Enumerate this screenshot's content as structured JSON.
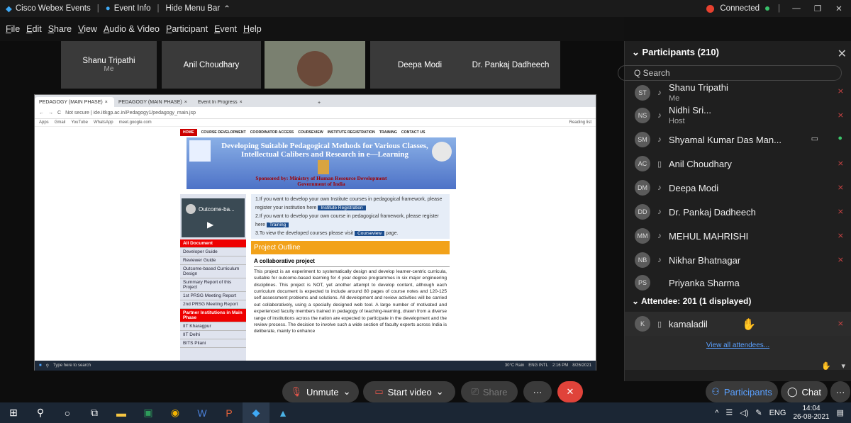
{
  "titlebar": {
    "app": "Cisco Webex Events",
    "event_info": "Event Info",
    "hide_menu": "Hide Menu Bar",
    "connected": "Connected"
  },
  "menu": [
    "File",
    "Edit",
    "Share",
    "View",
    "Audio & Video",
    "Participant",
    "Event",
    "Help"
  ],
  "tiles": [
    {
      "name": "Shanu Tripathi",
      "sub": "Me"
    },
    {
      "name": "Anil Choudhary"
    },
    {
      "name": "Deepa Modi"
    },
    {
      "name": "Dr. Pankaj Dadheech"
    }
  ],
  "browser": {
    "tabs": [
      "PEDAGOGY (MAIN PHASE)",
      "PEDAGOGY (MAIN PHASE)",
      "Event In Progress"
    ],
    "address": "Not secure | ide.iitkgp.ac.in/Pedagogy1/pedagogy_main.jsp",
    "bookmarks": [
      "Apps",
      "Gmail",
      "YouTube",
      "WhatsApp",
      "meet.google.com"
    ],
    "reading_list": "Reading list"
  },
  "site": {
    "nav": [
      "HOME",
      "COURSE DEVELOPMENT",
      "COORDINATOR ACCESS",
      "COURSEVIEW",
      "INSTITUTE REGISTRATION",
      "TRAINING",
      "CONTACT US"
    ],
    "title": "Developing Suitable Pedagogical Methods for Various Classes, Intellectual Calibers and Research in e—Learning",
    "sponsor": "Sponsored by: Ministry of Human Resource Development",
    "govt": "Government of India",
    "video_label": "Outcome-ba...",
    "left_nav": [
      "All Document",
      "Developer Guide",
      "Reviewer Guide",
      "Outcome-based Curriculum Design",
      "Summary Report of this Project",
      "1st PRSG Meeting Report",
      "2nd PRSG Meeting Report",
      "Partner Institutions in Main Phase",
      "IIT Kharagpur",
      "IIT Delhi",
      "BITS Pilani"
    ],
    "p1": "1.If you want to develop your own Institute courses in pedagogical framework, please register your institution here",
    "btn1": "Institute Registration",
    "p2": "2.If you want to develop your own course in pedagogical framework, please register here",
    "btn2": "Training",
    "p3a": "3.To view the developed courses please visit",
    "btn3": "Courseview",
    "p3b": "page.",
    "outline": "Project Outline",
    "collab": "A collaborative project",
    "body": "This project is an experiment to systematically design and develop learner-centric curricula, suitable for outcome-based learning for 4 year degree programmes in six major engineering disciplines. This project is NOT, yet another attempt to develop content, although each curriculum document is expected to include around 80 pages of course notes and 120-125 self assessment problems and solutions. All development and review activities will be carried out collaboratively, using a specially designed web tool. A large number of motivated and experienced faculty members trained in pedagogy of teaching-learning, drawn from a diverse range of institutions across the nation are expected to participate in the development and the review process. The decision to involve such a wide section of faculty experts across India is deliberate, mainly to enhance"
  },
  "inner_taskbar": {
    "search": "Type here to search",
    "weather": "30°C Rain",
    "lang": "ENG INTL",
    "time": "2:16 PM",
    "date": "8/26/2021"
  },
  "panel": {
    "header": "Participants (210)",
    "search_placeholder": "Q Search",
    "participants": [
      {
        "initials": "ST",
        "name": "Shanu Tripathi",
        "sub": "Me"
      },
      {
        "initials": "NS",
        "name": "Nidhi Sri...",
        "sub": "Host"
      },
      {
        "initials": "SM",
        "name": "Shyamal Kumar Das Man..."
      },
      {
        "initials": "AC",
        "name": "Anil Choudhary"
      },
      {
        "initials": "DM",
        "name": "Deepa Modi"
      },
      {
        "initials": "DD",
        "name": "Dr. Pankaj Dadheech"
      },
      {
        "initials": "MM",
        "name": "MEHUL MAHRISHI"
      },
      {
        "initials": "NB",
        "name": "Nikhar Bhatnagar"
      },
      {
        "initials": "PS",
        "name": "Priyanka Sharma"
      }
    ],
    "attendee_header": "Attendee: 201 (1 displayed)",
    "attendee": {
      "initials": "K",
      "name": "kamaladil"
    },
    "view_all": "View all attendees..."
  },
  "controls": {
    "unmute": "Unmute",
    "start_video": "Start video",
    "share": "Share",
    "participants": "Participants",
    "chat": "Chat"
  },
  "win_taskbar": {
    "lang": "ENG",
    "time": "14:04",
    "date": "26-08-2021"
  }
}
